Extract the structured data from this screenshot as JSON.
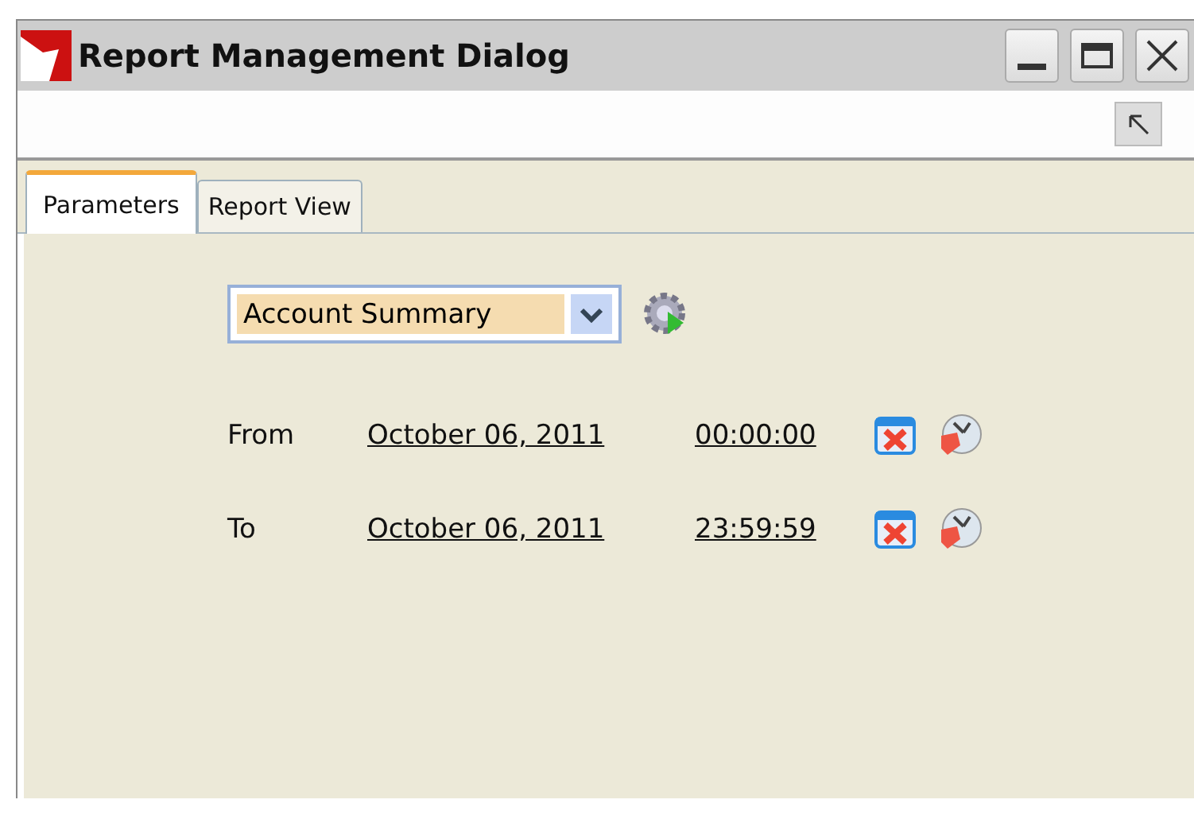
{
  "window": {
    "title": "Report Management Dialog"
  },
  "tabs": [
    {
      "label": "Parameters",
      "selected": true
    },
    {
      "label": "Report View",
      "selected": false
    }
  ],
  "report_select": {
    "value": "Account Summary"
  },
  "ranges": [
    {
      "label": "From",
      "date": "October 06, 2011",
      "time": "00:00:00"
    },
    {
      "label": "To",
      "date": "October 06, 2011",
      "time": "23:59:59"
    }
  ]
}
